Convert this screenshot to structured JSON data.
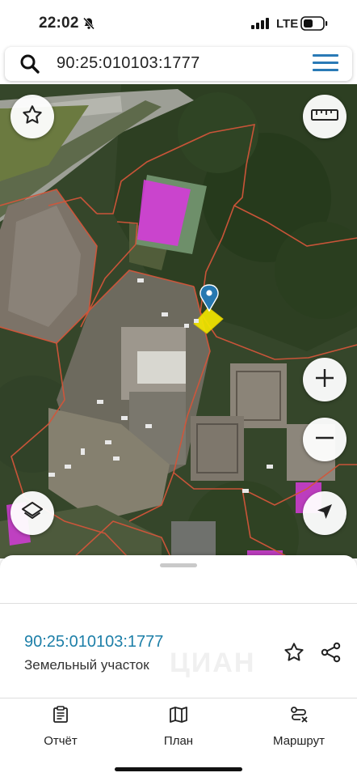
{
  "status_bar": {
    "time": "22:02",
    "network": "LTE",
    "icons": [
      "bell-slash-icon",
      "signal-icon",
      "battery-icon"
    ]
  },
  "search": {
    "query": "90:25:010103:1777",
    "icon": "search-icon",
    "menu_icon": "hamburger-menu-icon"
  },
  "map_controls": {
    "favorite": "star-icon",
    "ruler": "ruler-icon",
    "zoom_in": "plus-icon",
    "zoom_out": "minus-icon",
    "layers": "layers-icon",
    "locate": "navigation-arrow-icon",
    "pin": "map-pin-icon"
  },
  "parcel": {
    "cadastral_number": "90:25:010103:1777",
    "type": "Земельный участок",
    "watermark": "ЦИАН"
  },
  "tabs": [
    {
      "label": "Отчёт",
      "icon": "report-clipboard-icon"
    },
    {
      "label": "План",
      "icon": "map-plan-icon"
    },
    {
      "label": "Маршрут",
      "icon": "route-icon"
    }
  ],
  "colors": {
    "accent": "#2a7ab6",
    "cadastral_link": "#1d7fa8",
    "parcel_highlight": "#f2e600",
    "boundary": "#d2553a",
    "building_highlight": "#d43cd8"
  }
}
